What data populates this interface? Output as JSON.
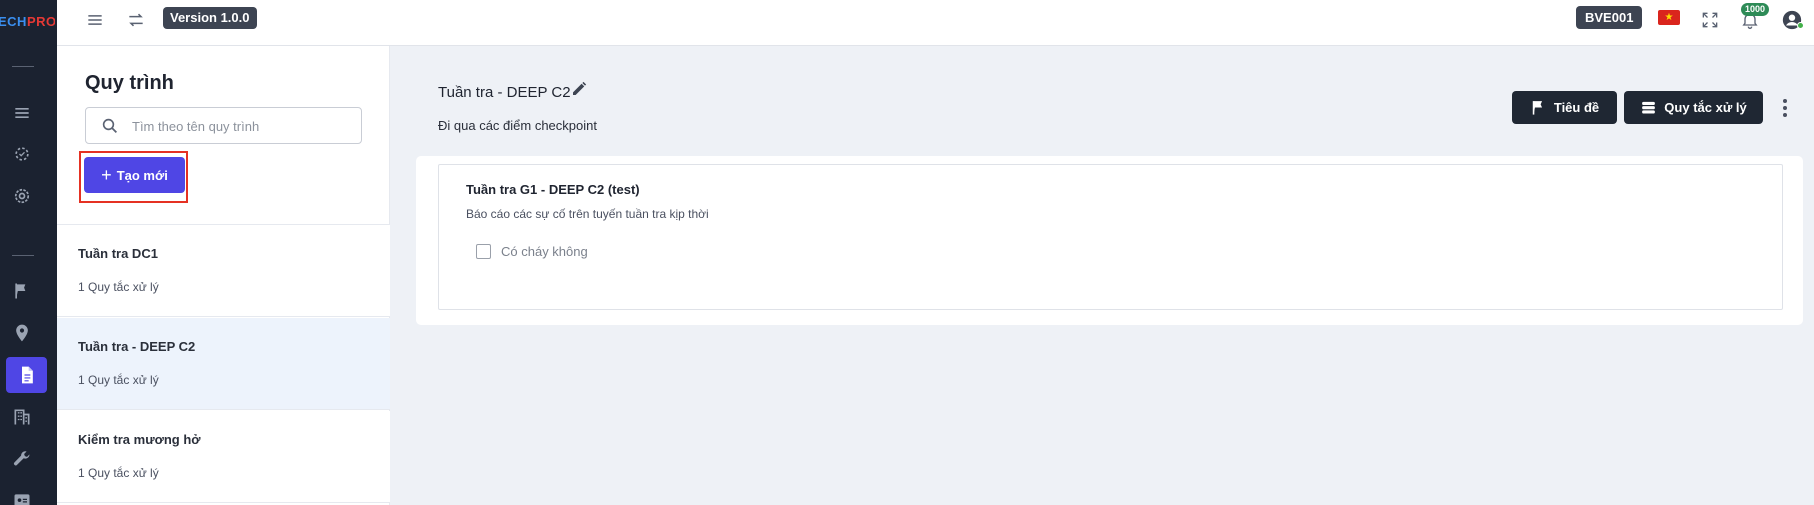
{
  "brand": {
    "logo_part1": "ECH",
    "logo_part2": "PRO"
  },
  "topbar": {
    "version_label": "Version 1.0.0",
    "site_code": "BVE001",
    "notification_count": "1000",
    "flag_icon": "vietnam-flag",
    "colors": {
      "accent": "#4f46e5",
      "dark": "#1f2733",
      "highlight": "#e53123"
    }
  },
  "sidebar_rail": {
    "icons": [
      "menu-icon",
      "dashboard-icon",
      "settings-icon",
      "flag-icon",
      "location-pin-icon",
      "document-icon",
      "building-icon",
      "wrench-icon",
      "id-card-icon"
    ],
    "active": "document-icon"
  },
  "panel": {
    "title": "Quy trình",
    "search_placeholder": "Tìm theo tên quy trình",
    "create_label": "Tạo mới",
    "items": [
      {
        "name": "Tuần tra DC1",
        "sub": "1 Quy tắc xử lý"
      },
      {
        "name": "Tuần tra - DEEP C2",
        "sub": "1 Quy tắc xử lý"
      },
      {
        "name": "Kiểm tra mương hở",
        "sub": "1 Quy tắc xử lý"
      }
    ]
  },
  "main": {
    "title": "Tuần tra - DEEP C2",
    "description": "Đi qua các điểm checkpoint",
    "btn_title": "Tiêu đề",
    "btn_rules": "Quy tắc xử lý",
    "card": {
      "title": "Tuần tra G1 - DEEP C2 (test)",
      "description": "Báo cáo các sự cố trên tuyến tuần tra kịp thời",
      "checkbox_label": "Có cháy không",
      "checked": false
    }
  }
}
